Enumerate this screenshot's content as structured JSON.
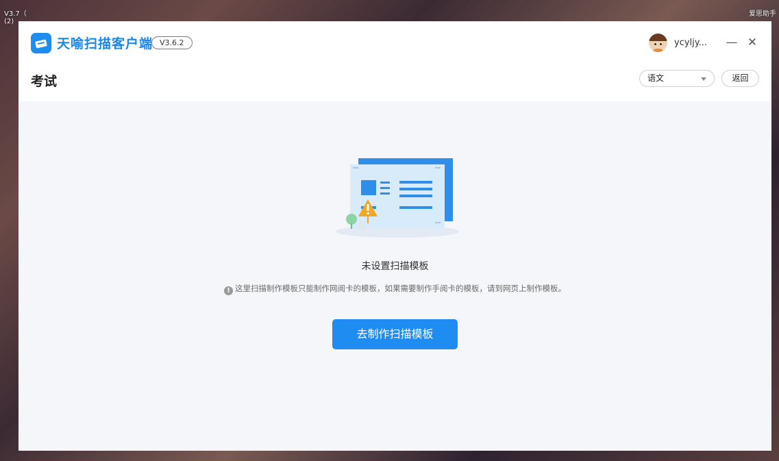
{
  "desktop": {
    "left_text_1": "V3.7（",
    "left_text_2": "(2)",
    "right_text": "爱思助手"
  },
  "titlebar": {
    "app_name": "天喻扫描客户端",
    "version": "V3.6.2",
    "username": "ycyljy...",
    "minimize_icon": "minimize-icon",
    "close_icon": "close-icon",
    "minimize_glyph": "—",
    "close_glyph": "✕"
  },
  "subheader": {
    "title": "考试",
    "subject_selected": "语文",
    "back_label": "返回"
  },
  "empty_state": {
    "title": "未设置扫描模板",
    "tip_icon_glyph": "!",
    "tip": "这里扫描制作模板只能制作网阅卡的模板，如果需要制作手阅卡的模板，请到网页上制作模板。",
    "button_label": "去制作扫描模板"
  },
  "colors": {
    "accent": "#1e8cf0",
    "warning": "#f5a623"
  }
}
